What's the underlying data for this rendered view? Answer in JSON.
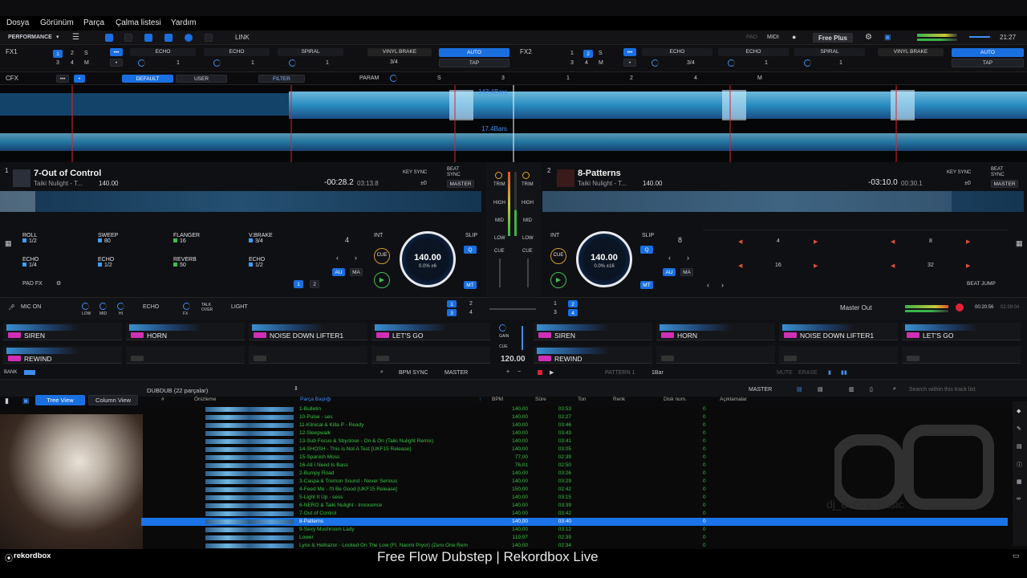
{
  "menu": [
    "Dosya",
    "Görünüm",
    "Parça",
    "Çalma listesi",
    "Yardım"
  ],
  "toolbar": {
    "mode": "PERFORMANCE",
    "link": "LINK",
    "pad": "PAD",
    "midi": "MIDI",
    "plan": "Free Plus",
    "clock": "21:27"
  },
  "fx1": {
    "label": "FX1",
    "nums": [
      "1",
      "2",
      "S",
      "3",
      "4",
      "M"
    ],
    "slots": [
      "ECHO",
      "ECHO",
      "SPIRAL"
    ],
    "brake": "VINYL BRAKE",
    "auto": "AUTO",
    "tap": "TAP",
    "beat": "3/4",
    "vals": [
      "1",
      "1",
      "1"
    ]
  },
  "fx2": {
    "label": "FX2",
    "nums": [
      "1",
      "2",
      "S",
      "3",
      "4",
      "M"
    ],
    "slots": [
      "ECHO",
      "ECHO",
      "SPIRAL"
    ],
    "brake": "VINYL BRAKE",
    "auto": "AUTO",
    "tap": "TAP",
    "beat": "3/4",
    "vals": [
      "1",
      "1",
      "1"
    ]
  },
  "cfx": {
    "label": "CFX",
    "default": "DEFAULT",
    "user": "USER",
    "filter": "FILTER",
    "param": "PARAM",
    "s": "S",
    "nums": [
      "3",
      "1",
      "2",
      "4",
      "M"
    ]
  },
  "waveform": {
    "bars1": "143.4Bars",
    "bars2": "17.4Bars"
  },
  "deck1": {
    "num": "1",
    "title": "7-Out of Control",
    "artist": "Taiki Nulight - T...",
    "bpm": "140.00",
    "elapsed": "-00:28.2",
    "remain": "03:13.8",
    "keysync": "KEY SYNC",
    "beatsync": "BEAT SYNC",
    "key": "±0",
    "master": "MASTER",
    "beatjump": "4",
    "int": "INT",
    "jogbpm": "140.00",
    "jogpct": "0.0% ±6",
    "slip": "SLIP",
    "q": "Q",
    "cue": "CUE",
    "au": "AU",
    "ma": "MA",
    "mt": "MT",
    "pads": [
      {
        "name": "ROLL",
        "val": "1/2"
      },
      {
        "name": "SWEEP",
        "val": "80"
      },
      {
        "name": "FLANGER",
        "val": "16"
      },
      {
        "name": "V.BRAKE",
        "val": "3/4"
      },
      {
        "name": "ECHO",
        "val": "1/4"
      },
      {
        "name": "ECHO",
        "val": "1/2"
      },
      {
        "name": "REVERB",
        "val": "50"
      },
      {
        "name": "ECHO",
        "val": "1/2"
      }
    ],
    "padfx": "PAD FX",
    "p1": "1",
    "p2": "2"
  },
  "deck2": {
    "num": "2",
    "title": "8-Patterns",
    "artist": "Taiki Nulight - T...",
    "bpm": "140.00",
    "elapsed": "-03:10.0",
    "remain": "00:30.1",
    "keysync": "KEY SYNC",
    "beatsync": "BEAT SYNC",
    "key": "±0",
    "master": "MASTER",
    "beatjump": "8",
    "int": "INT",
    "jogbpm": "140.00",
    "jogpct": "0.0% ±16",
    "slip": "SLIP",
    "q": "Q",
    "cue": "CUE",
    "au": "AU",
    "ma": "MA",
    "mt": "MT",
    "jumps": [
      "4",
      "8",
      "16",
      "32"
    ],
    "beatjumplabel": "BEAT JUMP"
  },
  "mixer": {
    "trim": "TRIM",
    "high": "HIGH",
    "mid": "MID",
    "low": "LOW",
    "cue": "CUE"
  },
  "mic": {
    "label": "MIC ON",
    "low": "LOW",
    "mid": "MID",
    "hi": "HI",
    "fx": "FX",
    "echo": "ECHO",
    "talk": "TALK OVER",
    "light": "LIGHT",
    "masterout": "Master Out",
    "time1": "00:20:56",
    "time2": "02:39:04",
    "n": [
      "1",
      "2",
      "3",
      "4"
    ]
  },
  "sampler": {
    "top": [
      "SIREN",
      "HORN",
      "NOISE DOWN LIFTER1",
      "LET'S GO",
      "SIREN",
      "HORN",
      "NOISE DOWN LIFTER1",
      "LET'S GO"
    ],
    "bottom": [
      "REWIND",
      "",
      "",
      "",
      "REWIND",
      "",
      "",
      ""
    ],
    "gain": "GAIN",
    "cue": "CUE",
    "bpm": "120.00",
    "bank": "BANK",
    "bpmsync": "BPM SYNC",
    "master": "MASTER",
    "pattern": "PATTERN 1",
    "bar": "1Bar",
    "mute": "MUTE",
    "erase": "ERASE"
  },
  "browser": {
    "playlist": "DUBDUB (22 parçalar)",
    "treeview": "Tree View",
    "columnview": "Column View",
    "master": "MASTER",
    "search": "Search within this track list",
    "cols": [
      "#",
      "Önizleme",
      "Parça Başlığı",
      "BPM",
      "Süre",
      "Ton",
      "Renk",
      "Disk num.",
      "Açıklamalar"
    ],
    "rows": [
      [
        "1-Bulletin",
        "140,00",
        "03:53",
        "0"
      ],
      [
        "10-Pulse - ses",
        "140,00",
        "02:27",
        "0"
      ],
      [
        "11-Klinical & Killa P - Ready",
        "140,00",
        "03:46",
        "0"
      ],
      [
        "12-Sleepwalk",
        "140,00",
        "03:43",
        "0"
      ],
      [
        "13-Sub Focus & Sbyclose - On & On (Taiki Nulight Remix)",
        "140,00",
        "03:41",
        "0"
      ],
      [
        "14-SHOSH - This is Not A Test [UKF15 Release]",
        "140,00",
        "03:05",
        "0"
      ],
      [
        "15-Spanish Moss",
        "77,00",
        "02:39",
        "0"
      ],
      [
        "16-All I Need Is Bass",
        "76,01",
        "02:50",
        "0"
      ],
      [
        "2-Bumpy Road",
        "140,00",
        "03:26",
        "0"
      ],
      [
        "3-Caspa & Tremon Sound - Never Serious",
        "140,00",
        "03:29",
        "0"
      ],
      [
        "4-Feed Me - I'll Be Good [UKF15 Release]",
        "150,00",
        "02:42",
        "0"
      ],
      [
        "5-Light It Up - sess",
        "140,00",
        "03:15",
        "0"
      ],
      [
        "6-NERO & Taiki Nulight - Innocence",
        "140,00",
        "03:39",
        "0"
      ],
      [
        "7-Out of Control",
        "140,00",
        "03:42",
        "0"
      ],
      [
        "8-Patterns",
        "140,00",
        "03:40",
        "0"
      ],
      [
        "9-Sexy Mushroom Lady",
        "140,00",
        "03:12",
        "0"
      ],
      [
        "Lower",
        "119,97",
        "02:39",
        "0"
      ],
      [
        "Lynx & Hellrazor - Locked On The Low (Ft. Naomi Pryor) (Zero One Rem",
        "140,00",
        "02:34",
        "0"
      ]
    ]
  },
  "footer": {
    "brand": "rekordbox",
    "caption": "Free Flow Dubstep | Rekordbox Live"
  },
  "watermark": "dj_outlinemusic"
}
